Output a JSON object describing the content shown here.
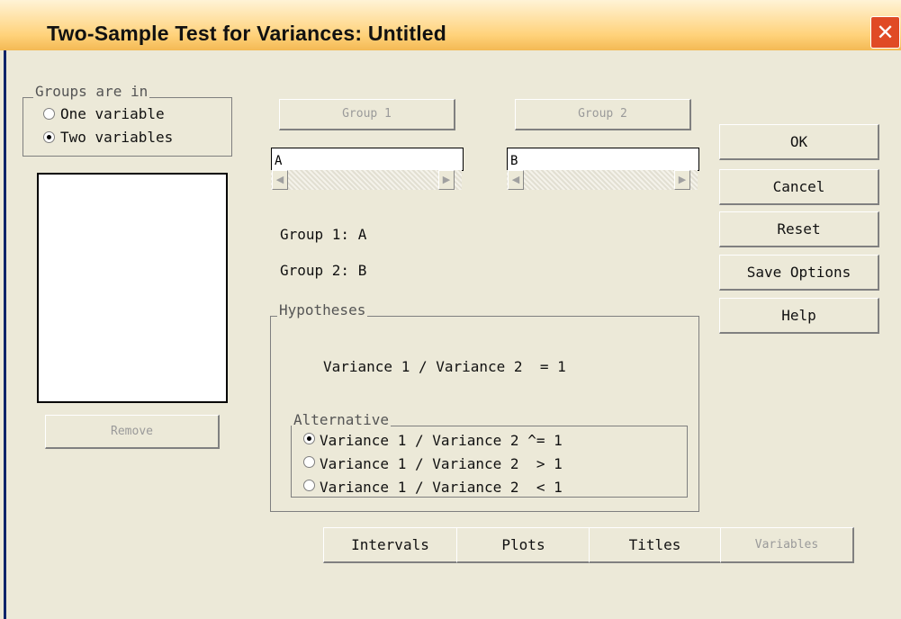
{
  "window": {
    "title": "Two-Sample Test for Variances: Untitled"
  },
  "groups_are_in": {
    "legend": "Groups are in",
    "options": [
      "One variable",
      "Two variables"
    ],
    "selected": "Two variables"
  },
  "remove_label": "Remove",
  "group1": {
    "button": "Group 1",
    "field_value": "A",
    "summary": "Group 1: A"
  },
  "group2": {
    "button": "Group 2",
    "field_value": "B",
    "summary": "Group 2: B"
  },
  "actions": {
    "ok": "OK",
    "cancel": "Cancel",
    "reset": "Reset",
    "save_options": "Save Options",
    "help": "Help"
  },
  "hypotheses": {
    "legend": "Hypotheses",
    "null": "Variance 1 / Variance 2  = 1",
    "alternative_legend": "Alternative",
    "alternatives": [
      "Variance 1 / Variance 2 ^= 1",
      "Variance 1 / Variance 2  > 1",
      "Variance 1 / Variance 2  < 1"
    ],
    "selected": "Variance 1 / Variance 2 ^= 1"
  },
  "bottom_buttons": {
    "intervals": "Intervals",
    "plots": "Plots",
    "titles": "Titles",
    "variables": "Variables"
  },
  "colors": {
    "title_bar": "#ffd27a",
    "close_button": "#e04a25",
    "dialog_face": "#ece9d8",
    "frame_border": "#0a246a"
  },
  "icons": {
    "close": "close-icon",
    "scroll_left": "scroll-left-arrow-icon",
    "scroll_right": "scroll-right-arrow-icon"
  }
}
